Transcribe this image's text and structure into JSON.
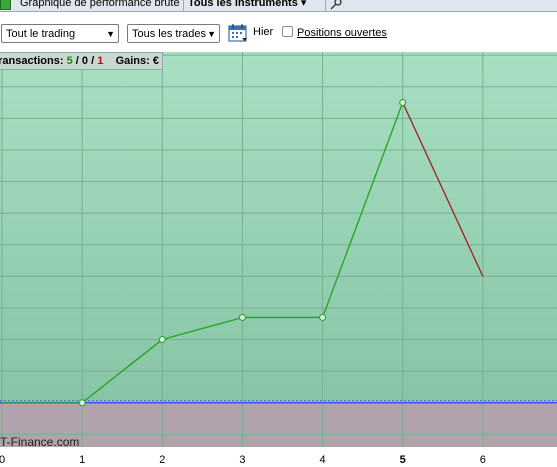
{
  "tabs": {
    "graph_label": "Graphique de performance brute",
    "instruments_label": "Tous les instruments ▾"
  },
  "toolbar": {
    "trading_filter": {
      "selected": "Tout le trading"
    },
    "trades_filter": {
      "selected": "Tous les trades"
    },
    "date_label": "Hier",
    "open_positions_label": "Positions ouvertes",
    "open_positions_checked": false
  },
  "info": {
    "transactions_label": "Transactions:",
    "win": "5",
    "neutral": "0",
    "loss": "1",
    "gains_label": "Gains:",
    "gains_value": "€",
    "sep1": "/",
    "sep2": "/"
  },
  "watermark": "T-Finance.com",
  "colors": {
    "plot_bg_top": "#a8dfc2",
    "plot_bg_bottom": "#88c4a6",
    "loss_area": "#b1a2ac",
    "gain_line": "#21a321",
    "loss_line": "#a51e1e",
    "zero_line": "#3c3cff"
  },
  "chart_data": {
    "type": "line",
    "x": [
      0,
      1,
      2,
      3,
      4,
      5,
      6
    ],
    "y": [
      0,
      0,
      20,
      27,
      27,
      95,
      40
    ],
    "segment_colors": [
      "gain",
      "gain",
      "gain",
      "gain",
      "gain",
      "loss"
    ],
    "xticks": [
      "0",
      "1",
      "2",
      "3",
      "4",
      "5",
      "6"
    ],
    "highlighted_tick": "5",
    "xlim": [
      0,
      6.95
    ],
    "ylim": [
      -14,
      111
    ],
    "grid": true
  }
}
